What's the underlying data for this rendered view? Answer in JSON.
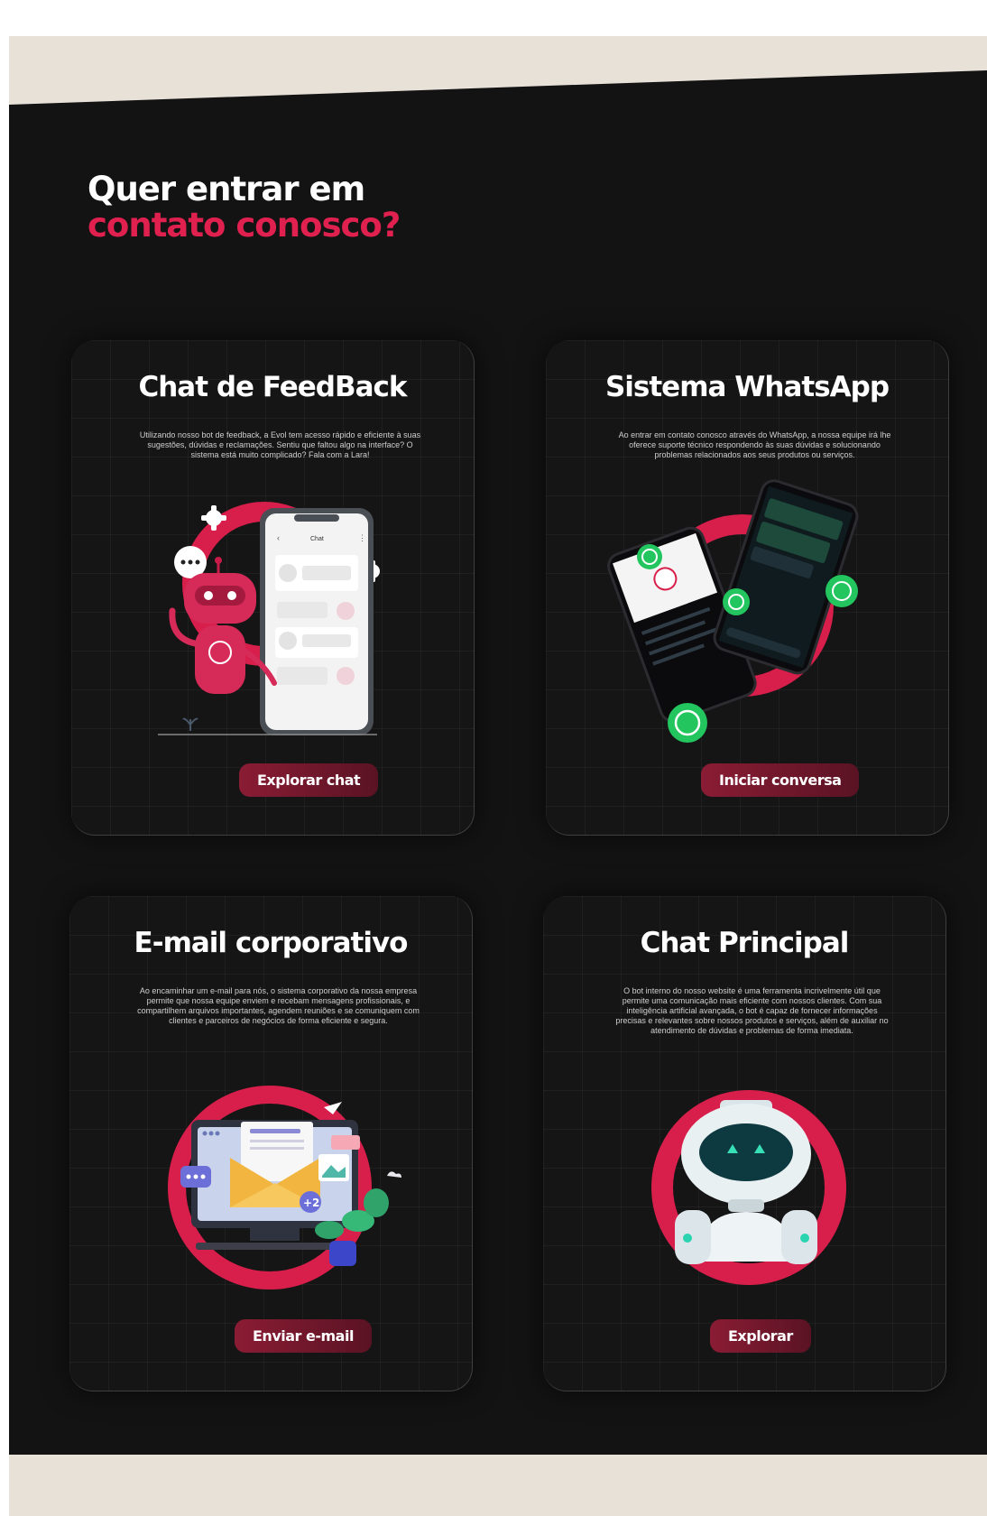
{
  "section": {
    "heading_line1": "Quer entrar em",
    "heading_line2": "contato conosco?"
  },
  "cards": [
    {
      "title": "Chat de FeedBack",
      "description": "Utilizando nosso bot de feedback, a Evol tem acesso rápido e eficiente à suas sugestões, dúvidas e reclamações. Sentiu que faltou algo na interface? O sistema está muito complicado? Fala com a Lara!",
      "button": "Explorar chat",
      "illustration": "robot-chat-phone",
      "phone_header": "Chat"
    },
    {
      "title": "Sistema WhatsApp",
      "description": "Ao entrar em contato conosco através do WhatsApp, a nossa equipe irá lhe oferece suporte técnico respondendo às suas dúvidas e solucionando problemas relacionados aos seus produtos ou serviços.",
      "button": "Iniciar conversa",
      "illustration": "whatsapp-phones"
    },
    {
      "title": "E-mail corporativo",
      "description": "Ao encaminhar um e-mail para nós, o sistema corporativo da nossa empresa permite que nossa equipe enviem e recebam mensagens profissionais, e compartilhem arquivos importantes, agendem reuniões e se comuniquem com clientes e parceiros de negócios de forma eficiente e segura.",
      "button": "Enviar e-mail",
      "illustration": "email-monitor",
      "badge": "+2"
    },
    {
      "title": "Chat Principal",
      "description": "O bot interno do nosso website é uma ferramenta incrivelmente útil que permite uma comunicação mais eficiente com nossos clientes. Com sua inteligência artificial avançada, o bot é capaz de fornecer informações precisas e relevantes sobre nossos produtos e serviços, além de auxiliar no atendimento de dúvidas e problemas de forma imediata.",
      "button": "Explorar",
      "illustration": "robot-head"
    }
  ],
  "colors": {
    "accent": "#e0204f",
    "background": "#141314",
    "beige": "#e8e1d8",
    "button": "#7a1a30"
  }
}
